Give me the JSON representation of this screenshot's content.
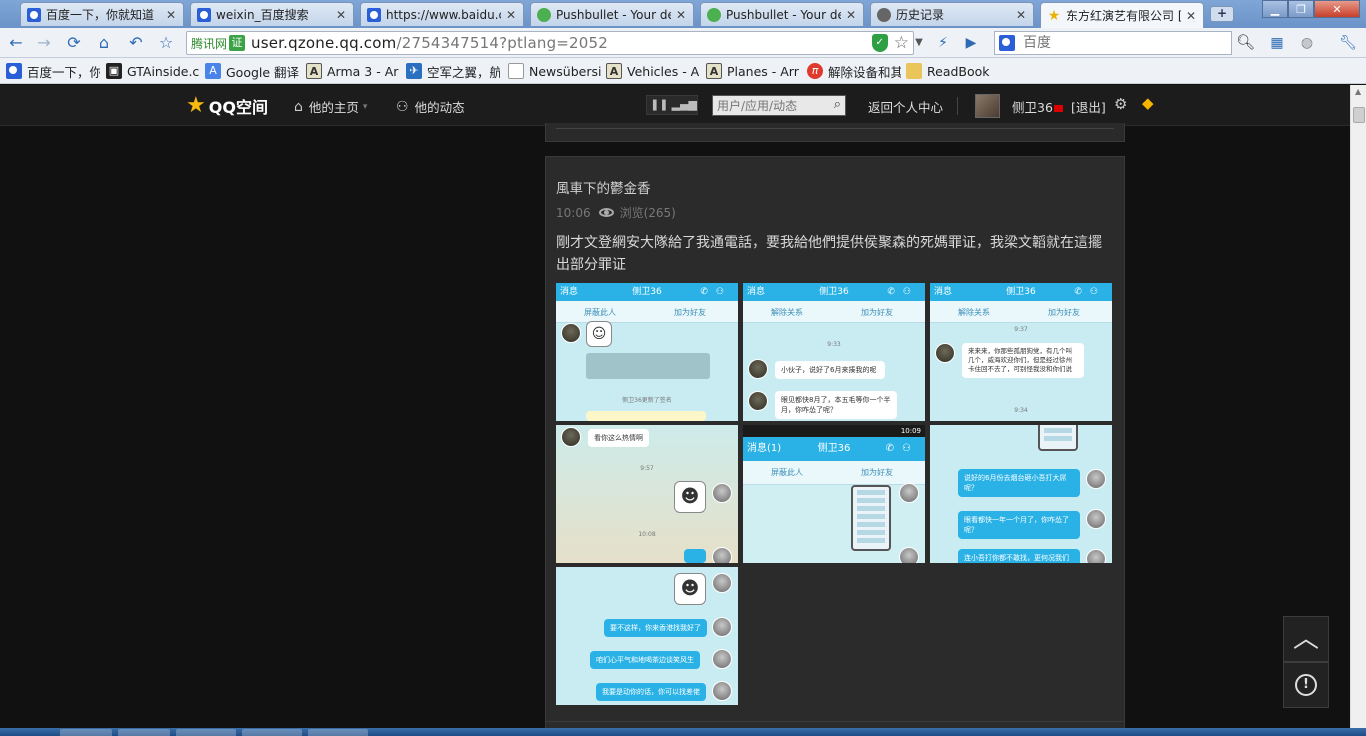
{
  "tabs": [
    {
      "title": "百度一下，你就知道",
      "icon": "baidu-paw"
    },
    {
      "title": "weixin_百度搜索",
      "icon": "baidu-paw"
    },
    {
      "title": "https://www.baidu.c",
      "icon": "baidu-paw"
    },
    {
      "title": "Pushbullet - Your de",
      "icon": "pushbullet"
    },
    {
      "title": "Pushbullet - Your de",
      "icon": "pushbullet"
    },
    {
      "title": "历史记录",
      "icon": "history"
    },
    {
      "title": "东方红演艺有限公司 [",
      "icon": "star"
    }
  ],
  "toolbar": {
    "site_badge": "腾讯网",
    "site_badge_icon": "证",
    "url_host": "user.qzone.qq.com",
    "url_path": "/2754347514?ptlang=2052",
    "search_placeholder": "百度"
  },
  "bookmarks": [
    {
      "label": "百度一下，你",
      "icon": "baidu-paw"
    },
    {
      "label": "GTAinside.c",
      "icon": "gta"
    },
    {
      "label": "Google 翻译",
      "icon": "google-translate"
    },
    {
      "label": "Arma 3 - Ar",
      "icon": "arma"
    },
    {
      "label": "空军之翼，航",
      "icon": "plane"
    },
    {
      "label": "Newsübersi",
      "icon": "page"
    },
    {
      "label": "Vehicles - A",
      "icon": "arma"
    },
    {
      "label": "Planes - Arr",
      "icon": "arma"
    },
    {
      "label": "解除设备和其",
      "icon": "red-circle"
    },
    {
      "label": "ReadBook",
      "icon": "folder"
    }
  ],
  "qzone_nav": {
    "logo": "QQ空间",
    "home": "他的主页",
    "activity": "他的动态",
    "search_placeholder": "用户/应用/动态",
    "return": "返回个人中心",
    "username": "侧卫36",
    "logout": "[退出]"
  },
  "post": {
    "author": "風車下的鬱金香",
    "time": "10:06",
    "views": "浏览(265)",
    "text": "剛才文登網安大隊給了我通電話，要我給他們提供侯聚森的死媽罪证，我梁文韜就在這擺出部分罪证"
  },
  "photos": {
    "p1": {
      "back": "消息",
      "name": "侧卫36",
      "block": "屏蔽此人",
      "add": "加为好友",
      "note": "侧卫36更新了签名"
    },
    "p2": {
      "back": "消息",
      "name": "侧卫36",
      "unblock": "解除关系",
      "add": "加为好友",
      "time": "9:33",
      "msg1": "小伙子，说好了6月来揍我的呢",
      "msg2": "眼见都快8月了，本五毛等你一个半月，你咋怂了呢？"
    },
    "p3": {
      "back": "消息",
      "name": "侧卫36",
      "unblock": "解除关系",
      "add": "加为好友",
      "time": "9:37",
      "msg1": "来来来，你那些孤朋狗党，有几个叫几个，威海欢迎你们，但是经过徐州卡住回不去了，可别怪我没和你们说",
      "time2": "9:34"
    },
    "p4": {
      "msg1": "看你这么热情啊",
      "time": "9:57",
      "time2": "10:08"
    },
    "p5": {
      "status_time": "10:09",
      "back": "消息(1)",
      "name": "侧卫36",
      "block": "屏蔽此人",
      "add": "加为好友"
    },
    "p6": {
      "msg1": "说好的6月份去烟台砸小吾打大屌呢？",
      "msg2": "眼看都快一年一个月了，你咋怂了呢？",
      "msg3": "连小吾打你都不敢找，更何况我们"
    },
    "p7": {
      "msg1": "要不这样，你来香港找我好了",
      "msg2": "咱们心平气和地喝茶边谈笑风生",
      "msg3": "我要是动你的话，你可以找差佬"
    }
  },
  "icons": {
    "back": "arrow-left-icon",
    "forward": "arrow-right-icon",
    "reload": "reload-icon",
    "home": "home-icon",
    "undo": "undo-icon",
    "bookmark": "star-icon",
    "scroll_top": "chevron-up-icon",
    "report": "exclamation-icon"
  }
}
